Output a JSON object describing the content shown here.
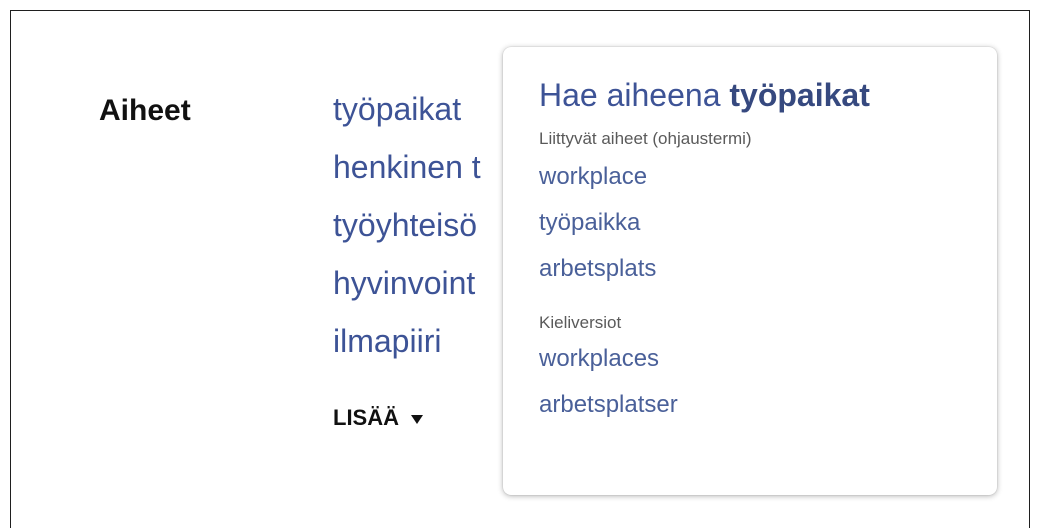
{
  "subjects": {
    "label": "Aiheet",
    "items": [
      {
        "label": "työpaikat"
      },
      {
        "label": "henkinen t"
      },
      {
        "label": "työyhteisö"
      },
      {
        "label": "hyvinvoint"
      },
      {
        "label": "ilmapiiri"
      }
    ],
    "more_label": "LISÄÄ"
  },
  "popup": {
    "title_prefix": "Hae aiheena",
    "title_term": "työpaikat",
    "related_heading": "Liittyvät aiheet (ohjaustermi)",
    "related": [
      {
        "label": "workplace"
      },
      {
        "label": "työpaikka"
      },
      {
        "label": "arbetsplats"
      }
    ],
    "language_heading": "Kieliversiot",
    "languages": [
      {
        "label": "workplaces"
      },
      {
        "label": "arbetsplatser"
      }
    ]
  },
  "colors": {
    "link": "#3d5396",
    "text": "#111111",
    "muted": "#5a5a5a",
    "border": "#1f1f1f"
  },
  "icons": {
    "more": "caret-down-icon"
  }
}
